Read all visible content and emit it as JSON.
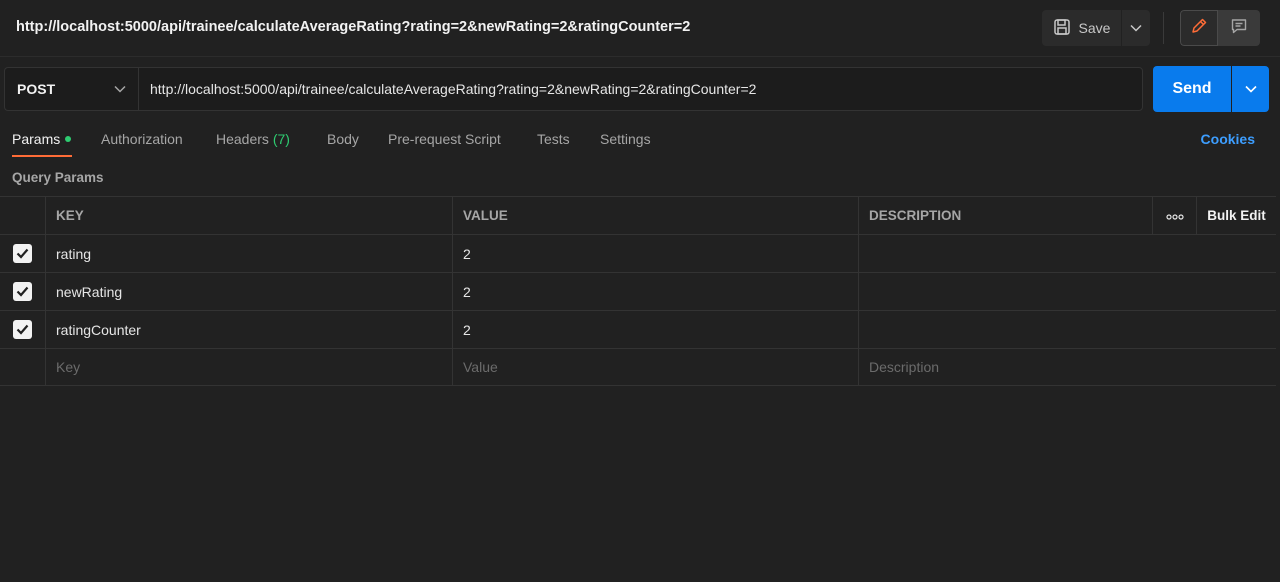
{
  "header": {
    "title": "http://localhost:5000/api/trainee/calculateAverageRating?rating=2&newRating=2&ratingCounter=2",
    "save_label": "Save"
  },
  "request": {
    "method": "POST",
    "url": "http://localhost:5000/api/trainee/calculateAverageRating?rating=2&newRating=2&ratingCounter=2",
    "send_label": "Send"
  },
  "tabs": {
    "params": "Params",
    "authorization": "Authorization",
    "headers": "Headers",
    "headers_count": "(7)",
    "body": "Body",
    "prerequest": "Pre-request Script",
    "tests": "Tests",
    "settings": "Settings",
    "cookies": "Cookies"
  },
  "query_params": {
    "title": "Query Params",
    "columns": {
      "key": "KEY",
      "value": "VALUE",
      "description": "DESCRIPTION",
      "bulk_edit": "Bulk Edit",
      "more": "ooo"
    },
    "rows": [
      {
        "key": "rating",
        "value": "2",
        "description": "",
        "checked": true
      },
      {
        "key": "newRating",
        "value": "2",
        "description": "",
        "checked": true
      },
      {
        "key": "ratingCounter",
        "value": "2",
        "description": "",
        "checked": true
      }
    ],
    "placeholders": {
      "key": "Key",
      "value": "Value",
      "description": "Description"
    }
  },
  "colors": {
    "background": "#212121",
    "accent_send": "#097bed",
    "tab_underline": "#ff6c37",
    "status_green": "#2ecc71",
    "link_blue": "#3d9eff"
  }
}
